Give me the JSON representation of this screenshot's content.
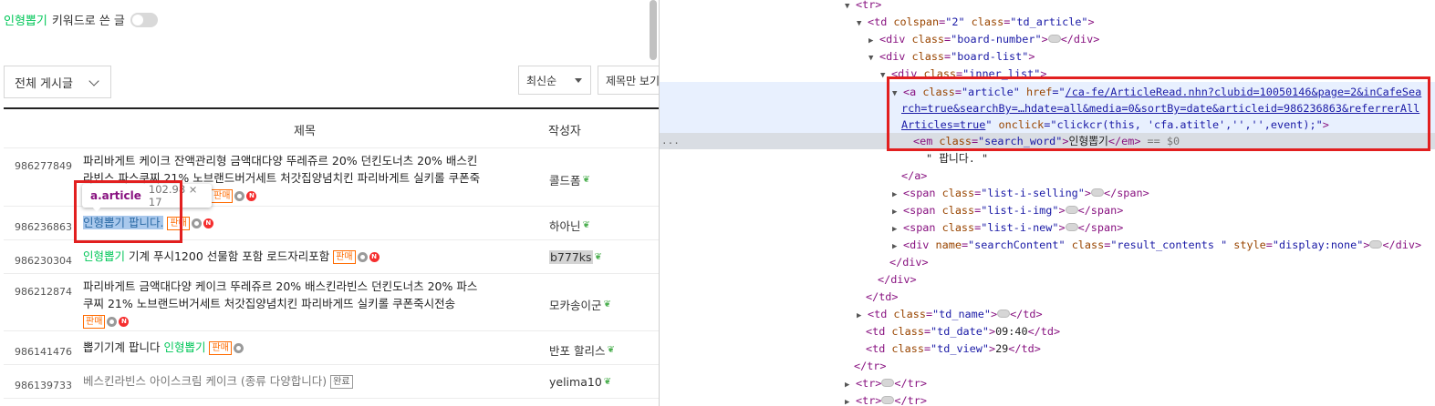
{
  "page": {
    "keyword_filter": {
      "keyword": "인형뽑기",
      "suffix": "키워드로 쓴 글"
    },
    "board_select": "전체 게시글",
    "sort_select": "최신순",
    "view_select": "제목만 보기",
    "headers": {
      "title": "제목",
      "writer": "작성자"
    },
    "rows": [
      {
        "no": "986277849",
        "line1": "파리바게트 케이크 잔액관리형 금액대다양 뚜레쥬르 20% 던킨도너츠 20% 배스킨",
        "line2": "라빈스 파스쿠찌 21% 노브랜드버거세트 처갓집양념치킨 파리바게트 실키롤 쿠폰죽",
        "badge": "판매",
        "writer": "콜드폼"
      },
      {
        "no": "986236863",
        "kw": "인형뽑기",
        "rest": " 팝니다.",
        "badge": "판매",
        "writer": "하아닌"
      },
      {
        "no": "986230304",
        "kw": "인형뽑기",
        "rest": " 기계 푸시1200 선물함 포함 로드자리포함",
        "badge": "판매",
        "writer": "b777ks"
      },
      {
        "no": "986212874",
        "line1": "파리바게트 금액대다양 케이크 뚜레쥬르 20% 배스킨라빈스 던킨도너츠 20% 파스",
        "line2": "쿠찌 21% 노브랜드버거세트 처갓집양념치킨 파리바게뜨 실키롤 쿠폰죽시전송",
        "badge": "판매",
        "writer": "모카송이군"
      },
      {
        "no": "986141476",
        "pre": "뽑기기계 팝니다 ",
        "kw": "인형뽑기",
        "badge": "판매",
        "writer": "반포 할리스"
      },
      {
        "no": "986139733",
        "title": "베스킨라빈스 아이스크림 케이크 (종류 다양합니다)",
        "badge": "완료",
        "writer": "yelima10"
      }
    ],
    "new_icon": "N",
    "tooltip": {
      "tag": "a.article",
      "size": "102.98 × 17"
    }
  },
  "devtools": {
    "lines": {
      "l0_tag": "<tr>",
      "l1_a": "<td ",
      "l1_an": "colspan",
      "l1_av": "\"2\"",
      "l1_an2": " class",
      "l1_av2": "\"td_article\"",
      "l1_b": ">",
      "l2_a": "<div ",
      "l2_an": "class",
      "l2_av": "\"board-number\"",
      "l2_b": ">",
      "l2_c": "</div>",
      "l3_a": "<div ",
      "l3_an": "class",
      "l3_av": "\"board-list\"",
      "l3_b": ">",
      "l4_a": "<div ",
      "l4_an": "class",
      "l4_av": "\"inner_list\"",
      "l4_b": ">",
      "l5_a": "<a ",
      "l5_an": "class",
      "l5_av": "\"article\"",
      "l5_an2": " href",
      "l5_eq": "=\"",
      "l5_link": "/ca-fe/ArticleRead.nhn?clubid=10050146&page=2&inCafeSea",
      "l6_link": "rch=true&searchBy=…hdate=all&media=0&sortBy=date&articleid=986236863&referrerAll",
      "l7_link": "Articles=true",
      "l7_q": "\"",
      "l7_an": " onclick",
      "l7_av": "=\"clickcr(this, 'cfa.atitle','','',event);\"",
      "l7_b": ">",
      "l8_a": "<em ",
      "l8_an": "class",
      "l8_av": "\"search_word\"",
      "l8_b": ">",
      "l8_txt": "인형뽑기",
      "l8_c": "</em>",
      "l8_d": " == $0",
      "l9_txt": "\" 팝니다. \"",
      "l10_tag": "</a>",
      "l11_a": "<span ",
      "l11_an": "class",
      "l11_av": "\"list-i-selling\"",
      "l11_b": ">",
      "l11_c": "</span>",
      "l12_a": "<span ",
      "l12_an": "class",
      "l12_av": "\"list-i-img\"",
      "l12_b": ">",
      "l12_c": "</span>",
      "l13_a": "<span ",
      "l13_an": "class",
      "l13_av": "\"list-i-new\"",
      "l13_b": ">",
      "l13_c": "</span>",
      "l14_a": "<div ",
      "l14_an": "name",
      "l14_av": "\"searchContent\"",
      "l14_an2": " class",
      "l14_av2": "\"result_contents \"",
      "l14_an3": " style",
      "l14_av3": "\"display:none\"",
      "l14_b": ">",
      "l14_c": "</div>",
      "l15_tag": "</div>",
      "l16_tag": "</div>",
      "l17_tag": "</td>",
      "l18_a": "<td ",
      "l18_an": "class",
      "l18_av": "\"td_name\"",
      "l18_b": ">",
      "l18_c": "</td>",
      "l19_a": "<td ",
      "l19_an": "class",
      "l19_av": "\"td_date\"",
      "l19_b": ">",
      "l19_txt": "09:40",
      "l19_c": "</td>",
      "l20_a": "<td ",
      "l20_an": "class",
      "l20_av": "\"td_view\"",
      "l20_b": ">",
      "l20_txt": "29",
      "l20_c": "</td>",
      "l21_tag": "</tr>",
      "l22_a": "<tr>",
      "l22_c": "</tr>",
      "l23_a": "<tr>",
      "l23_c": "</tr>",
      "dots": "..."
    }
  }
}
